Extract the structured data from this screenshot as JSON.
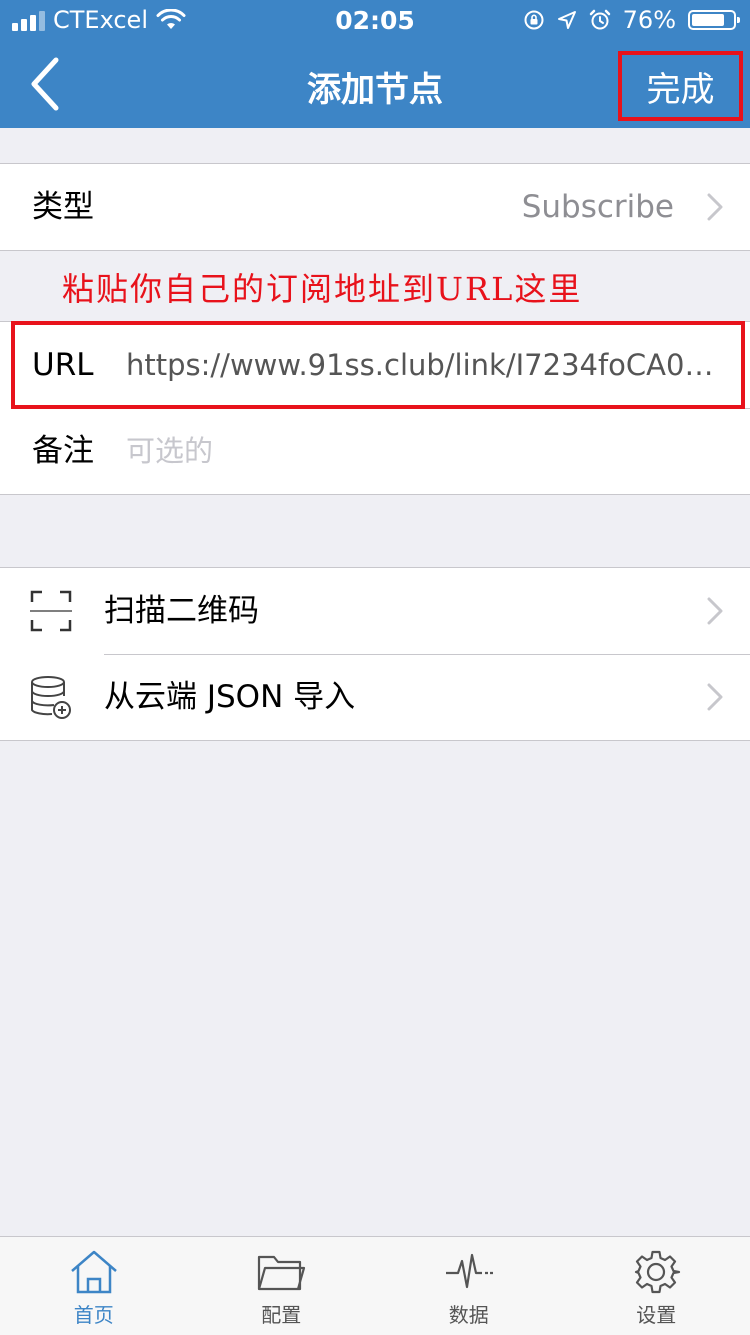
{
  "status_bar": {
    "carrier": "CTExcel",
    "time": "02:05",
    "battery": "76%"
  },
  "nav": {
    "title": "添加节点",
    "done_label": "完成"
  },
  "type_row": {
    "label": "类型",
    "value": "Subscribe"
  },
  "hint": "粘贴你自己的订阅地址到URL这里",
  "url_row": {
    "label": "URL",
    "value": "https://www.91ss.club/link/I7234foCA0…"
  },
  "note_row": {
    "label": "备注",
    "placeholder": "可选的"
  },
  "actions": [
    {
      "label": "扫描二维码",
      "icon": "qr-scan-icon"
    },
    {
      "label": "从云端 JSON 导入",
      "icon": "cloud-database-icon"
    }
  ],
  "tabbar": [
    {
      "label": "首页",
      "icon": "home-icon",
      "active": true
    },
    {
      "label": "配置",
      "icon": "folder-icon",
      "active": false
    },
    {
      "label": "数据",
      "icon": "pulse-icon",
      "active": false
    },
    {
      "label": "设置",
      "icon": "gear-icon",
      "active": false
    }
  ],
  "colors": {
    "nav_blue": "#3d85c6",
    "highlight_red": "#e8121b",
    "background": "#efeff4"
  }
}
